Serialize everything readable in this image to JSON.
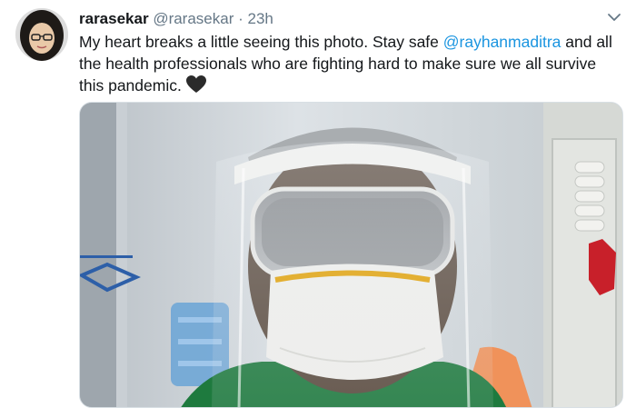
{
  "tweet": {
    "display_name": "rarasekar",
    "handle": "@rarasekar",
    "separator": "·",
    "time": "23h",
    "text_part1": "My heart breaks a little seeing this photo. Stay safe ",
    "mention": "@rayhanmaditra",
    "text_part2": " and all the health professionals who are fighting hard to make sure we all survive this pandemic. ",
    "heart_emoji": "black-heart-icon"
  },
  "colors": {
    "link": "#1b95e0",
    "secondary_text": "#657786",
    "primary_text": "#14171a"
  }
}
